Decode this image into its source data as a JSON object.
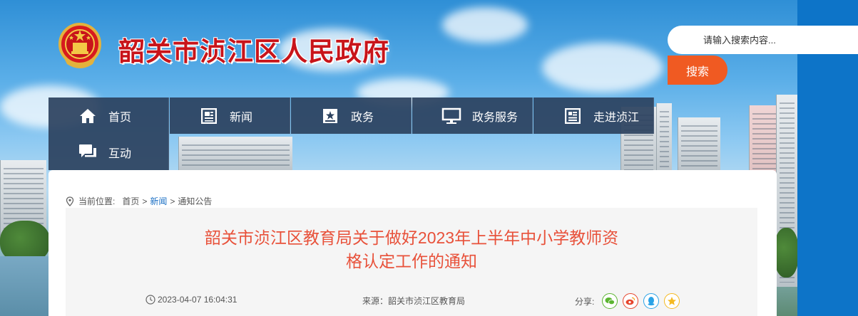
{
  "header": {
    "site_title": "韶关市浈江区人民政府"
  },
  "search": {
    "placeholder": "请输入搜索内容...",
    "button_label": "搜索"
  },
  "nav": {
    "items": [
      {
        "label": "首页",
        "icon": "home-icon"
      },
      {
        "label": "新闻",
        "icon": "news-icon"
      },
      {
        "label": "政务",
        "icon": "government-affairs-icon"
      },
      {
        "label": "政务服务",
        "icon": "monitor-icon"
      },
      {
        "label": "走进浈江",
        "icon": "document-icon"
      },
      {
        "label": "互动",
        "icon": "chat-icon"
      }
    ]
  },
  "breadcrumb": {
    "prefix": "当前位置:",
    "items": [
      "首页",
      "新闻",
      "通知公告"
    ],
    "separator": ">"
  },
  "article": {
    "title_line1": "韶关市浈江区教育局关于做好2023年上半年中小学教师资",
    "title_line2": "格认定工作的通知",
    "datetime": "2023-04-07 16:04:31",
    "source": "来源：韶关市浈江区教育局",
    "share_label": "分享:",
    "share_icons": [
      "wechat-icon",
      "weibo-icon",
      "qq-icon",
      "qzone-icon"
    ]
  },
  "colors": {
    "title_red": "#c8141a",
    "nav_bg": "#2b415e",
    "search_orange": "#f05a22",
    "article_title": "#e8513a",
    "right_strip": "#0d74c8",
    "breadcrumb_active": "#1a6fc4"
  }
}
